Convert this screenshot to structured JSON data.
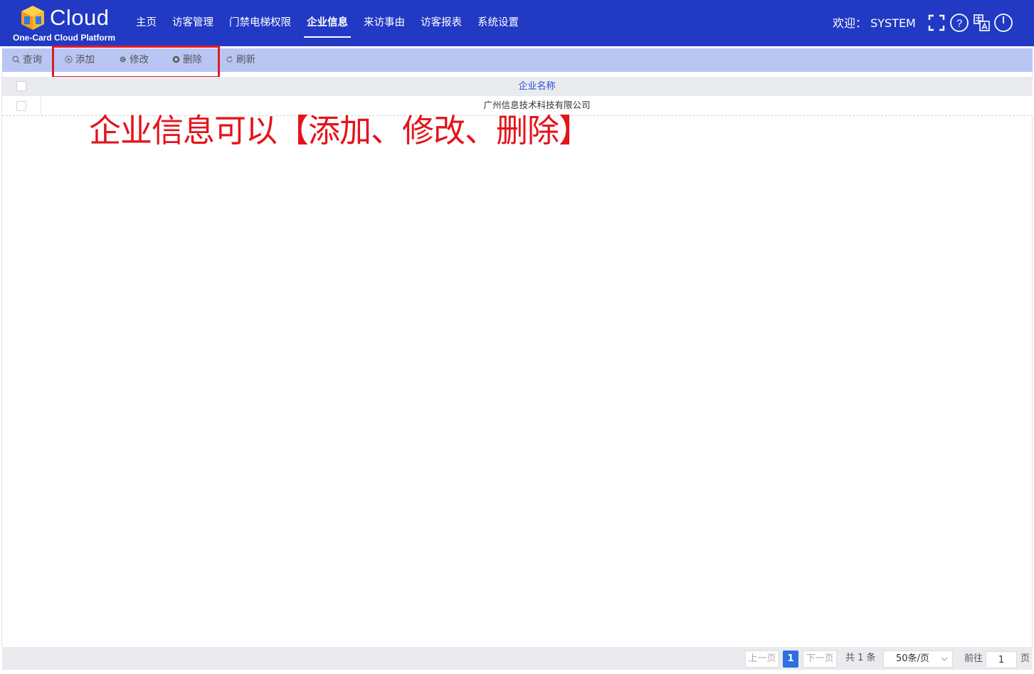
{
  "header": {
    "logo_word": "Cloud",
    "logo_sub": "One-Card Cloud Platform",
    "nav": [
      {
        "label": "主页"
      },
      {
        "label": "访客管理"
      },
      {
        "label": "门禁电梯权限"
      },
      {
        "label": "企业信息",
        "active": true
      },
      {
        "label": "来访事由"
      },
      {
        "label": "访客报表"
      },
      {
        "label": "系统设置"
      }
    ],
    "welcome": "欢迎：  SYSTEM",
    "icons": [
      "fullscreen-icon",
      "help-icon",
      "language-icon",
      "power-icon"
    ]
  },
  "toolbar": {
    "query": "查询",
    "add": "添加",
    "edit": "修改",
    "delete": "删除",
    "refresh": "刷新"
  },
  "table": {
    "columns": [
      "企业名称"
    ],
    "rows": [
      {
        "name": "广州信息技术科技有限公司"
      }
    ]
  },
  "annotation": "企业信息可以【添加、修改、删除】",
  "pagination": {
    "prev": "上一页",
    "current": "1",
    "next": "下一页",
    "total": "共 1 条",
    "page_size": "50条/页",
    "goto_label": "前往",
    "goto_value": "1",
    "page_suffix": "页"
  },
  "colors": {
    "header_bg": "#2139c3",
    "toolbar_bg": "#b9c6f4",
    "highlight": "#e11a22",
    "link": "#2d4bd7",
    "page_active": "#2d6fe0"
  }
}
